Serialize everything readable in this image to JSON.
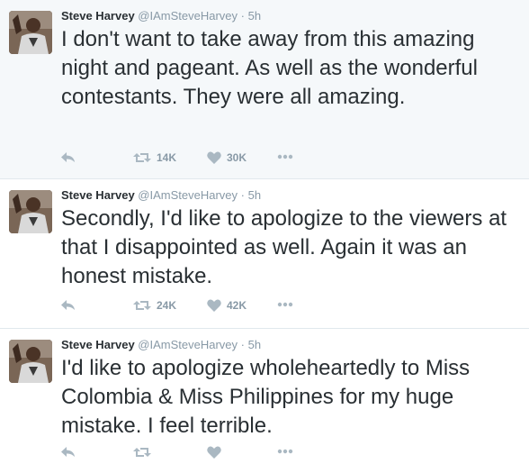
{
  "tweets": [
    {
      "name": "Steve Harvey",
      "handle": "@IAmSteveHarvey",
      "separator": "·",
      "time": "5h",
      "text": "I don't want to take away from this amazing night and pageant. As well as the wonderful contestants. They were all amazing.",
      "retweets": "14K",
      "likes": "30K"
    },
    {
      "name": "Steve Harvey",
      "handle": "@IAmSteveHarvey",
      "separator": "·",
      "time": "5h",
      "text": "Secondly, I'd like to apologize to the viewers at that I disappointed as well. Again it was an honest mistake.",
      "retweets": "24K",
      "likes": "42K"
    },
    {
      "name": "Steve Harvey",
      "handle": "@IAmSteveHarvey",
      "separator": "·",
      "time": "5h",
      "text": "I'd like to apologize wholeheartedly to Miss Colombia & Miss Philippines for my huge mistake. I feel terrible.",
      "retweets": "",
      "likes": ""
    }
  ],
  "icons": {
    "reply": "reply-icon",
    "retweet": "retweet-icon",
    "like": "heart-icon",
    "more": "more-dots-icon"
  },
  "colors": {
    "text": "#292f33",
    "muted": "#8899a6",
    "highlight_bg": "#f5f8fa",
    "divider": "#e1e8ed",
    "icon": "#aab8c2"
  }
}
